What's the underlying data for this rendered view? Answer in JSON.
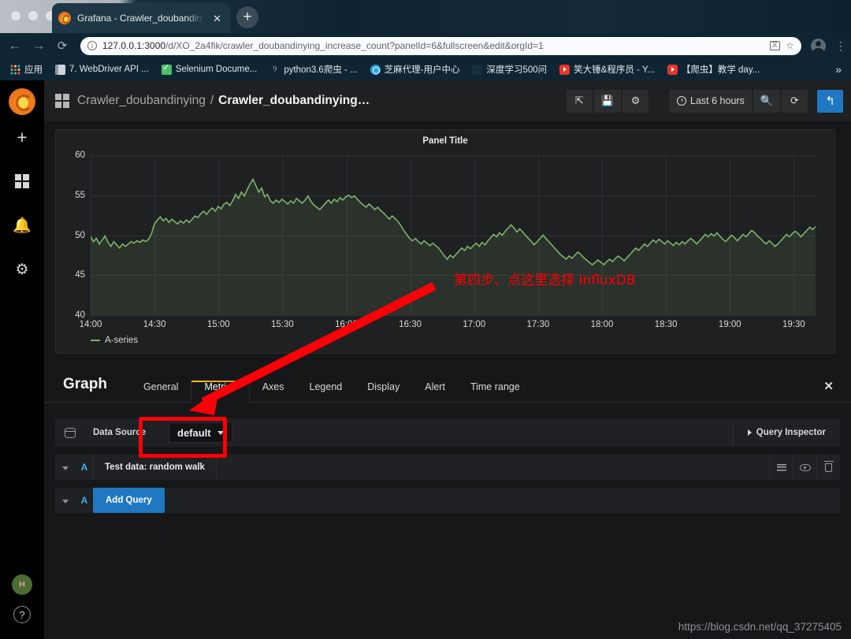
{
  "browser": {
    "tab": {
      "title": "Grafana - Crawler_doubandiny",
      "close_label": "✕",
      "favicon": "grafana-favicon"
    },
    "new_tab_label": "+",
    "nav": {
      "back": "←",
      "forward": "→",
      "reload": "⟳"
    },
    "omnibox": {
      "host": "127.0.0.1:3000",
      "path": "/d/XO_2a4fik/crawler_doubandinying_increase_count?panelId=6&fullscreen&edit&orgId=1",
      "translate_icon": "translate-icon",
      "bookmark_icon": "☆"
    },
    "menu_label": "⋮",
    "bookmarks": [
      {
        "label": "应用",
        "icon": "apps-grid-icon"
      },
      {
        "label": "7. WebDriver API ...",
        "icon": "document-icon"
      },
      {
        "label": "Selenium Docume...",
        "icon": "selenium-check-icon"
      },
      {
        "label": "python3.6爬虫 - ...",
        "icon": "python-icon"
      },
      {
        "label": "芝麻代理-用户中心",
        "icon": "zhima-icon"
      },
      {
        "label": "深度学习500问",
        "icon": "blank-icon"
      },
      {
        "label": "笑大锤&程序员 - Y...",
        "icon": "youtube-icon"
      },
      {
        "label": "【爬虫】教学 day...",
        "icon": "youtube-icon"
      }
    ],
    "bookmarks_overflow": "»"
  },
  "sidenav": {
    "logo": "grafana-logo",
    "items": [
      {
        "name": "create-icon",
        "glyph": "+"
      },
      {
        "name": "dashboards-icon",
        "glyph": ""
      },
      {
        "name": "alerting-bell-icon",
        "glyph": "🔔"
      },
      {
        "name": "configuration-gear-icon",
        "glyph": "⚙"
      }
    ],
    "avatar_initials": "H",
    "help_label": "?"
  },
  "topbar": {
    "folder": "Crawler_doubandinying",
    "separator": "/",
    "dashboard": "Crawler_doubandinying…",
    "actions": {
      "share": "⇱",
      "save": "💾",
      "settings": "⚙",
      "time_range": "Last 6 hours",
      "zoom_out": "🔍",
      "refresh": "⟳",
      "back": "↰"
    }
  },
  "panel": {
    "title": "Panel Title"
  },
  "chart_data": {
    "type": "line",
    "title": "Panel Title",
    "xlabel": "",
    "ylabel": "",
    "ylim": [
      40,
      60
    ],
    "yticks": [
      40,
      45,
      50,
      55,
      60
    ],
    "xticks": [
      "14:00",
      "14:30",
      "15:00",
      "15:30",
      "16:00",
      "16:30",
      "17:00",
      "17:30",
      "18:00",
      "18:30",
      "19:00",
      "19:30"
    ],
    "grid": true,
    "legend": "bottom-left",
    "series": [
      {
        "name": "A-series",
        "color": "#7eb26d",
        "fill": true,
        "values": [
          49.8,
          49.2,
          49.6,
          48.9,
          49.4,
          49.9,
          49.1,
          48.6,
          49.2,
          48.8,
          48.4,
          48.9,
          48.6,
          48.9,
          49.2,
          49.0,
          49.3,
          49.1,
          49.4,
          49.2,
          49.5,
          50.2,
          51.4,
          51.9,
          52.3,
          51.8,
          52.1,
          51.6,
          52.0,
          51.7,
          51.4,
          51.8,
          51.5,
          51.9,
          51.6,
          52.0,
          52.4,
          52.2,
          52.7,
          53.0,
          52.6,
          53.1,
          53.4,
          53.0,
          53.6,
          53.3,
          53.9,
          54.1,
          53.7,
          54.3,
          55.1,
          54.6,
          55.4,
          54.9,
          55.7,
          56.4,
          57.0,
          56.2,
          55.4,
          55.9,
          54.8,
          55.1,
          54.3,
          54.0,
          54.4,
          54.1,
          54.5,
          54.2,
          53.9,
          54.3,
          54.0,
          54.6,
          54.3,
          54.0,
          54.4,
          54.9,
          54.2,
          53.8,
          53.5,
          53.2,
          53.6,
          54.0,
          54.4,
          54.0,
          54.5,
          54.2,
          54.7,
          54.4,
          54.8,
          55.0,
          54.7,
          54.9,
          54.5,
          54.1,
          53.8,
          53.5,
          53.9,
          53.6,
          53.2,
          53.5,
          53.1,
          52.8,
          52.4,
          52.0,
          52.4,
          52.1,
          51.7,
          51.2,
          50.6,
          50.1,
          49.6,
          49.3,
          49.6,
          49.2,
          48.9,
          49.3,
          49.0,
          48.7,
          49.0,
          48.7,
          48.4,
          47.9,
          47.4,
          47.0,
          47.5,
          47.2,
          47.6,
          48.0,
          48.4,
          48.1,
          48.6,
          48.3,
          48.7,
          49.0,
          48.6,
          49.1,
          48.8,
          49.3,
          49.7,
          50.1,
          49.8,
          50.3,
          50.0,
          50.5,
          50.9,
          51.3,
          50.9,
          50.4,
          50.8,
          50.4,
          50.0,
          49.6,
          49.2,
          48.8,
          49.2,
          49.6,
          50.0,
          49.6,
          49.2,
          48.8,
          48.4,
          48.0,
          47.6,
          47.3,
          47.0,
          47.4,
          47.1,
          47.5,
          47.9,
          47.6,
          47.2,
          46.9,
          46.6,
          46.3,
          46.6,
          46.9,
          46.6,
          46.3,
          46.7,
          47.0,
          46.7,
          47.1,
          47.4,
          47.1,
          46.8,
          47.2,
          47.6,
          48.0,
          48.4,
          48.1,
          48.5,
          48.9,
          48.6,
          49.0,
          49.4,
          49.1,
          49.5,
          49.2,
          48.9,
          49.3,
          49.0,
          48.7,
          49.1,
          48.8,
          49.2,
          48.9,
          49.3,
          49.6,
          49.3,
          48.9,
          49.3,
          49.7,
          50.1,
          49.8,
          50.2,
          49.9,
          50.3,
          49.9,
          49.5,
          49.2,
          49.6,
          50.0,
          49.7,
          49.3,
          49.7,
          50.1,
          49.8,
          50.2,
          50.6,
          50.3,
          49.9,
          49.6,
          49.2,
          48.9,
          49.3,
          49.0,
          48.6,
          48.9,
          49.3,
          49.7,
          50.1,
          49.8,
          50.2,
          50.5,
          50.2,
          49.8,
          50.2,
          50.6,
          51.0,
          50.7,
          51.1
        ]
      }
    ]
  },
  "editor": {
    "heading": "Graph",
    "tabs": [
      {
        "label": "General",
        "active": false
      },
      {
        "label": "Metrics",
        "active": true
      },
      {
        "label": "Axes",
        "active": false
      },
      {
        "label": "Legend",
        "active": false
      },
      {
        "label": "Display",
        "active": false
      },
      {
        "label": "Alert",
        "active": false
      },
      {
        "label": "Time range",
        "active": false
      }
    ],
    "close_label": "✕",
    "datasource": {
      "icon": "database-icon",
      "label": "Data Source",
      "value": "default",
      "query_inspector": "Query Inspector"
    },
    "queries": [
      {
        "letter": "A",
        "name": "Test data: random walk",
        "type": "query"
      },
      {
        "letter": "A",
        "name": "Add Query",
        "type": "add"
      }
    ],
    "row_actions": [
      "hamburger-icon",
      "eye-icon",
      "trash-icon"
    ]
  },
  "annotations": {
    "callout_text": "第四步、点这里选择 InfluxDB",
    "arrow_color": "#fb0007",
    "highlight_box_color": "#fb0007"
  },
  "watermark": "https://blog.csdn.net/qq_37275405"
}
